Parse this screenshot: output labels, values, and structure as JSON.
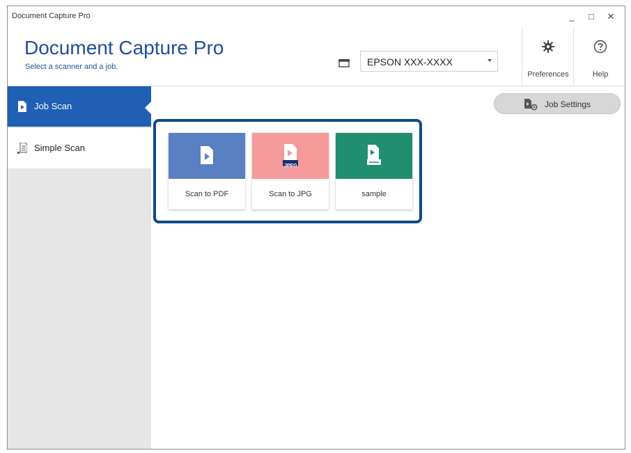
{
  "window": {
    "title": "Document Capture Pro",
    "controls": [
      "_",
      "□",
      "✕"
    ]
  },
  "header": {
    "app_title": "Document Capture Pro",
    "subtitle": "Select a scanner and a job.",
    "scanner": {
      "selected": "EPSON XXX-XXXX",
      "icon": "scanner-icon"
    },
    "preferences_label": "Preferences",
    "help_label": "Help"
  },
  "sidebar": {
    "items": [
      {
        "label": "Job Scan",
        "icon": "job-scan-icon",
        "active": true
      },
      {
        "label": "Simple Scan",
        "icon": "simple-scan-icon",
        "active": false
      }
    ]
  },
  "toolbar": {
    "job_settings_label": "Job Settings"
  },
  "jobs": [
    {
      "label": "Scan to PDF",
      "color": "#5a7fc2",
      "icon": "pdf-document-icon"
    },
    {
      "label": "Scan to JPG",
      "color": "#f49a9a",
      "icon": "jpeg-document-icon",
      "badge": ".JPEG"
    },
    {
      "label": "sample",
      "color": "#1f8f70",
      "icon": "document-tray-icon"
    }
  ],
  "colors": {
    "accent": "#1f5fb4",
    "title_blue": "#1f4e9e",
    "frame": "#0e4a8a",
    "sidebar_bg": "#e6e6e6"
  }
}
